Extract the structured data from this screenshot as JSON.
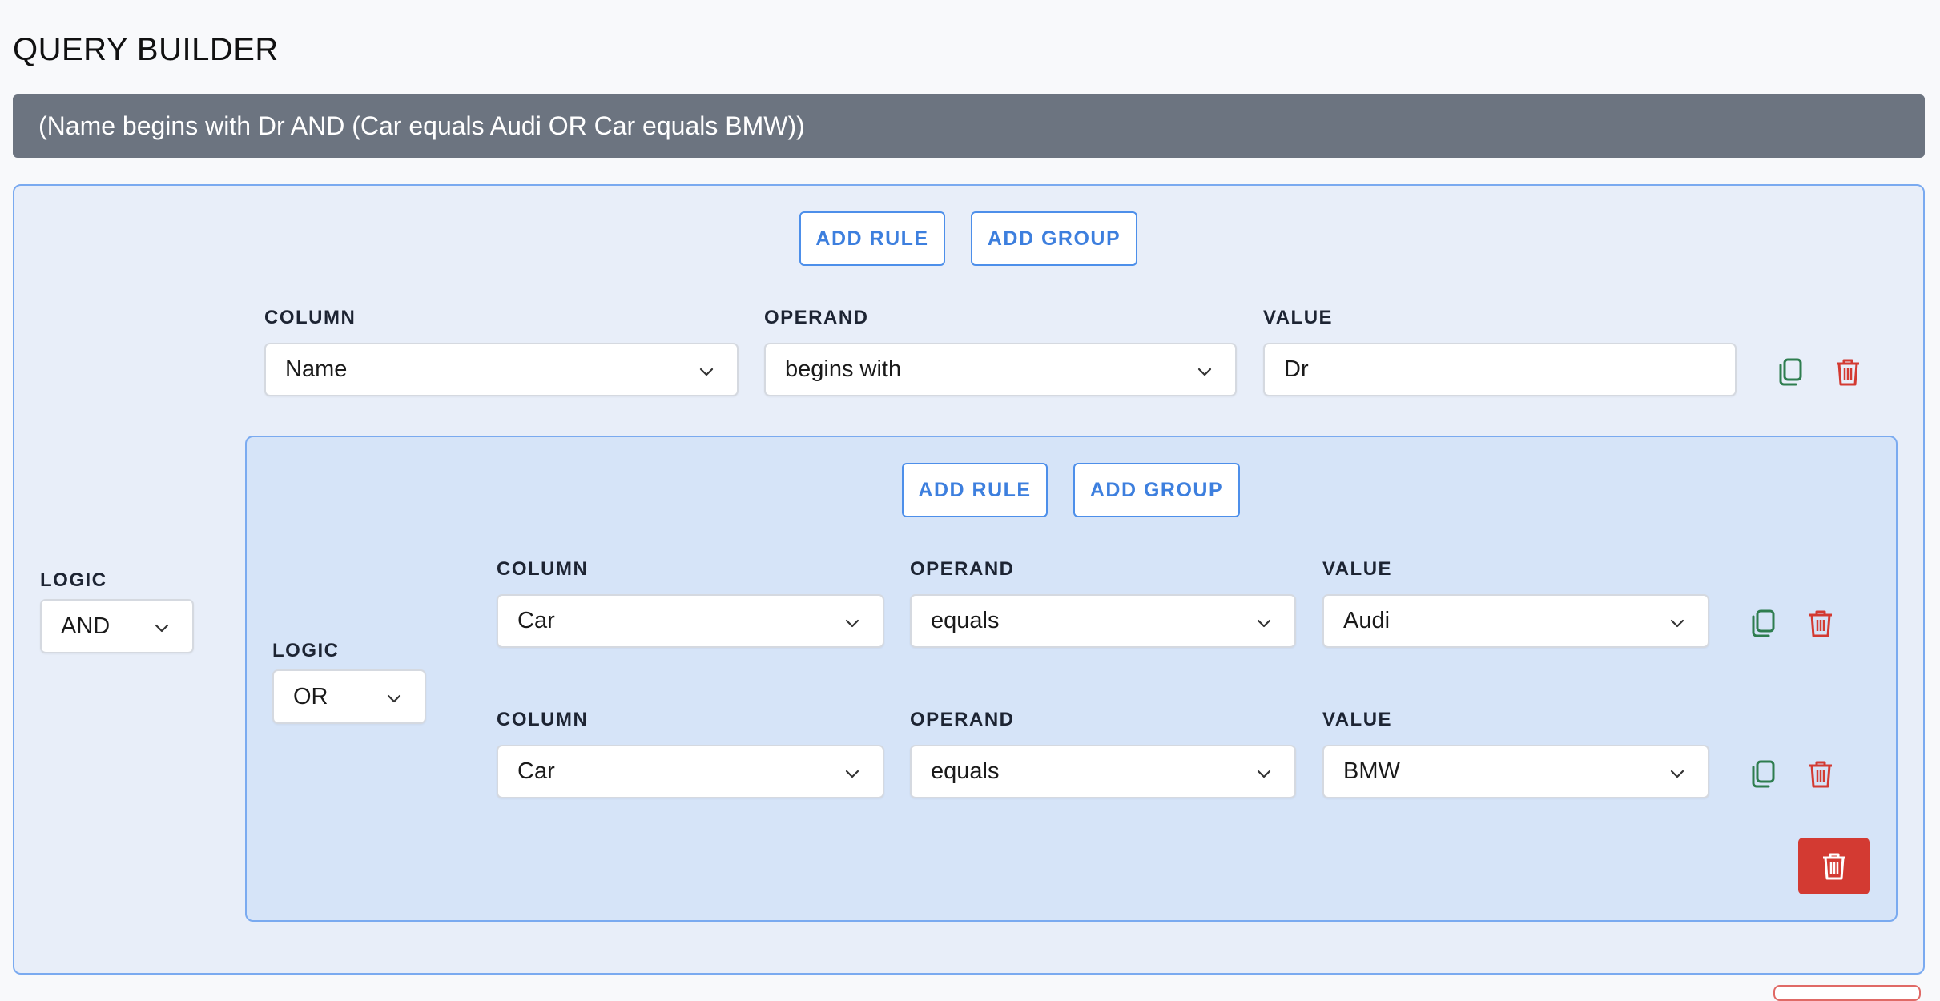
{
  "page": {
    "title": "QUERY BUILDER"
  },
  "summary": {
    "text": "(Name begins with Dr AND (Car equals Audi OR Car equals BMW))"
  },
  "colors": {
    "accent": "#3d7fde",
    "copy_icon": "#2e7d4f",
    "delete_icon": "#d33a32",
    "summary_bg": "#6c7480"
  },
  "outer_group": {
    "add_rule_label": "ADD RULE",
    "add_group_label": "ADD GROUP",
    "logic_label": "LOGIC",
    "logic_value": "AND",
    "rule": {
      "column_label": "COLUMN",
      "column_value": "Name",
      "operand_label": "OPERAND",
      "operand_value": "begins with",
      "value_label": "VALUE",
      "value_value": "Dr",
      "copy_icon": "copy-icon",
      "delete_icon": "trash-icon"
    }
  },
  "inner_group": {
    "add_rule_label": "ADD RULE",
    "add_group_label": "ADD GROUP",
    "logic_label": "LOGIC",
    "logic_value": "OR",
    "rules": [
      {
        "column_label": "COLUMN",
        "column_value": "Car",
        "operand_label": "OPERAND",
        "operand_value": "equals",
        "value_label": "VALUE",
        "value_value": "Audi"
      },
      {
        "column_label": "COLUMN",
        "column_value": "Car",
        "operand_label": "OPERAND",
        "operand_value": "equals",
        "value_label": "VALUE",
        "value_value": "BMW"
      }
    ],
    "delete_group_icon": "trash-icon"
  }
}
